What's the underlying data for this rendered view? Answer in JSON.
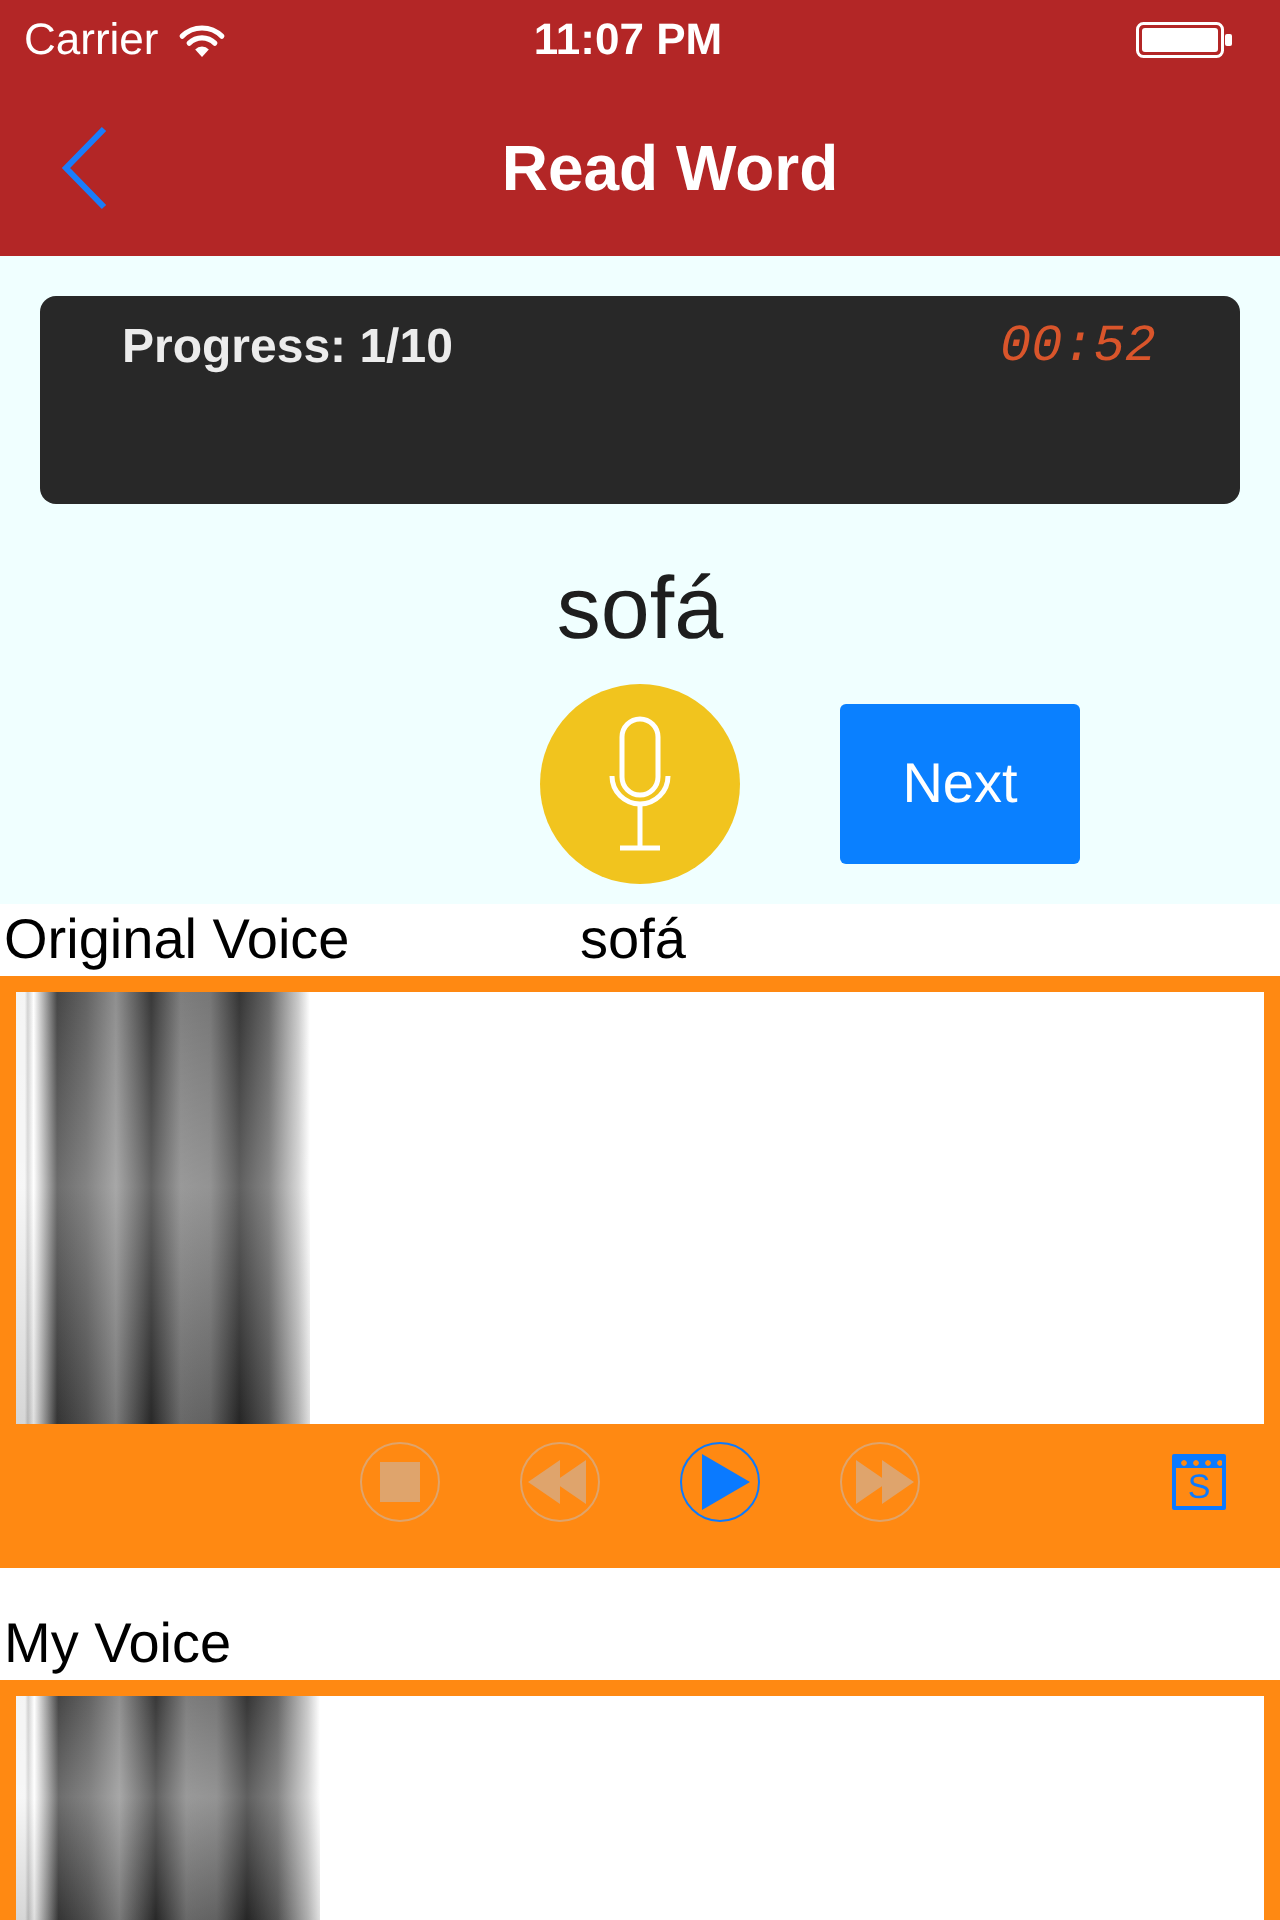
{
  "status_bar": {
    "carrier": "Carrier",
    "time": "11:07 PM"
  },
  "nav_bar": {
    "title": "Read Word"
  },
  "progress_panel": {
    "progress": "Progress: 1/10",
    "timer": "00:52"
  },
  "word": "sofá",
  "next_button": {
    "label": "Next"
  },
  "original_voice": {
    "label": "Original Voice",
    "word": "sofá",
    "controls": [
      {
        "kind": "stop",
        "disabled": true
      },
      {
        "kind": "rewind",
        "disabled": true
      },
      {
        "kind": "play",
        "disabled": false
      },
      {
        "kind": "forward",
        "disabled": true
      }
    ],
    "subtitle_button": {
      "label": "S"
    }
  },
  "my_voice": {
    "label": "My Voice"
  }
}
